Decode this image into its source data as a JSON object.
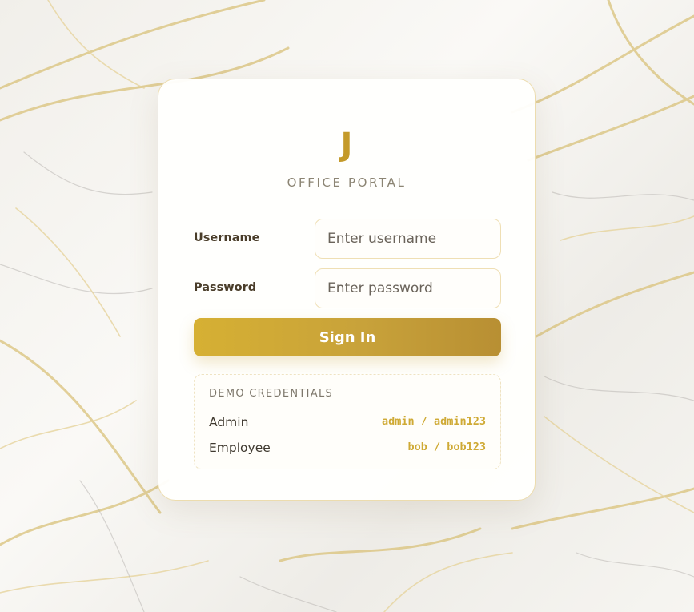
{
  "app": {
    "logo_letter": "J",
    "subtitle": "OFFICE PORTAL"
  },
  "form": {
    "username_label": "Username",
    "username_placeholder": "Enter username",
    "password_label": "Password",
    "password_placeholder": "Enter password",
    "signin_label": "Sign In"
  },
  "demo": {
    "title": "DEMO CREDENTIALS",
    "rows": [
      {
        "role": "Admin",
        "credentials": "admin / admin123"
      },
      {
        "role": "Employee",
        "credentials": "bob / bob123"
      }
    ]
  },
  "colors": {
    "accent_gold": "#c9a032",
    "card_border": "#ecdcae",
    "text_dark": "#4a3d2a"
  }
}
